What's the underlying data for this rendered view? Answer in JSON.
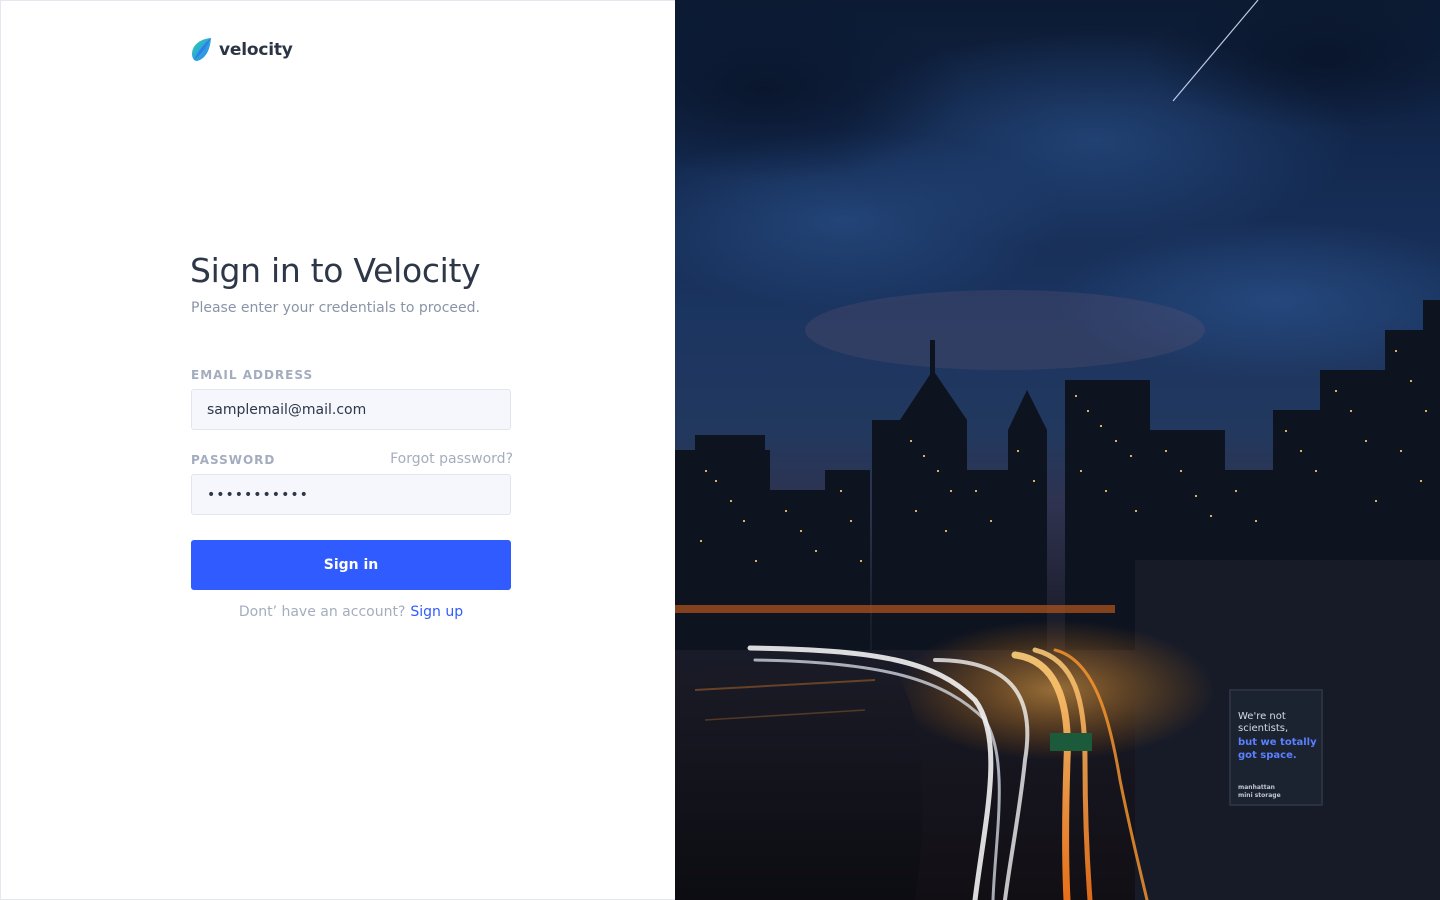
{
  "brand": {
    "name": "velocity"
  },
  "signin": {
    "title": "Sign in to Velocity",
    "subtitle": "Please enter your credentials to proceed.",
    "email": {
      "label": "EMAIL ADDRESS",
      "value": "samplemail@mail.com"
    },
    "password": {
      "label": "PASSWORD",
      "value": "•••••••••••",
      "forgot_link": "Forgot password?"
    },
    "submit_label": "Sign in",
    "signup": {
      "prompt": "Dont’ have an account?",
      "link": "Sign up"
    }
  },
  "hero": {
    "billboard_text": [
      "We're not",
      "scientists,",
      "but we totally",
      "got space.",
      "manhattan",
      "mini storage"
    ]
  },
  "colors": {
    "accent": "#2f5bff",
    "logo_gradient": [
      "#2bd6a8",
      "#2f5bff"
    ],
    "heading": "#2d3748",
    "muted": "#a4adbe"
  }
}
